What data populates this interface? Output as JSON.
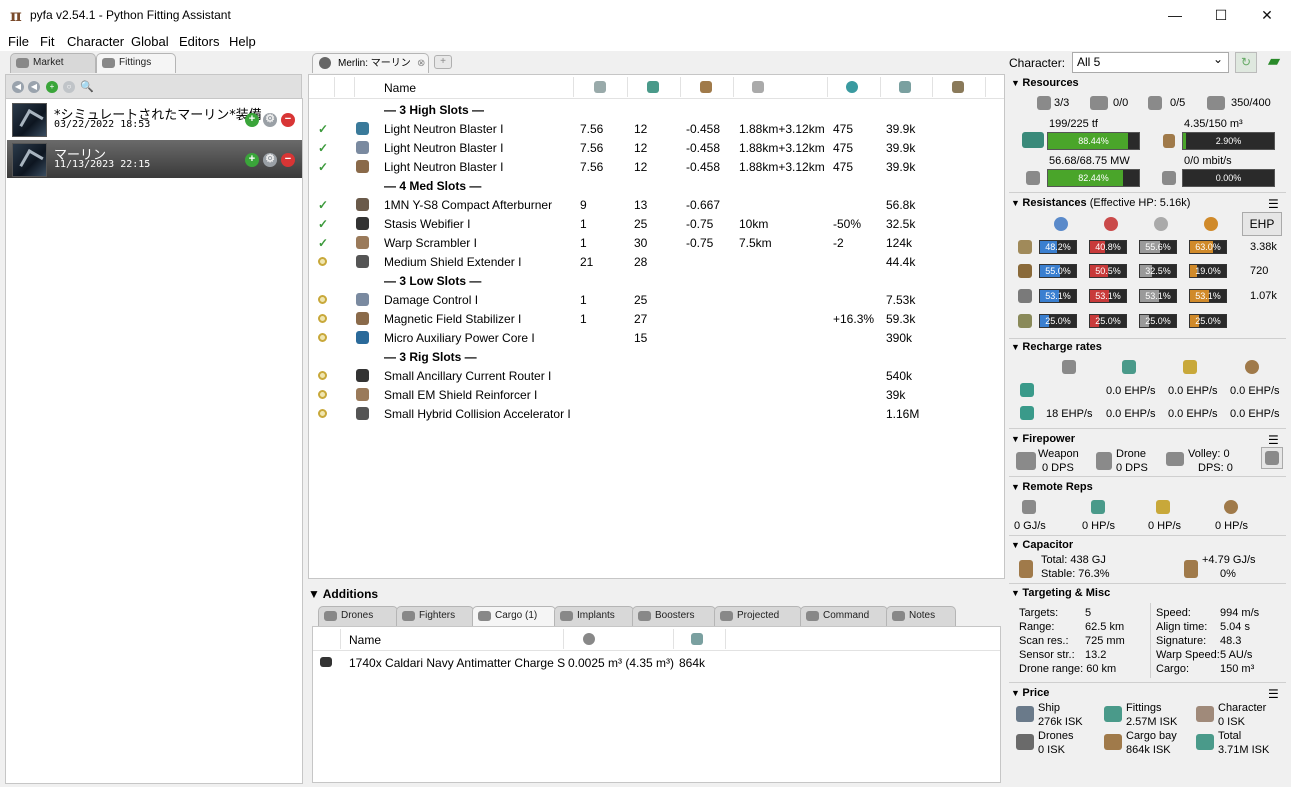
{
  "window": {
    "title": "pyfa v2.54.1 - Python Fitting Assistant",
    "icon": "pyfa-logo-icon"
  },
  "menu": [
    "File",
    "Fit",
    "Character",
    "Global",
    "Editors",
    "Help"
  ],
  "left": {
    "tabs": [
      "Market",
      "Fittings"
    ],
    "fits": [
      {
        "name": "*シミュレートされたマーリン*装備",
        "date": "03/22/2022 18:53"
      },
      {
        "name": "マーリン",
        "date": "11/13/2023 22:15"
      }
    ]
  },
  "fit_tab": "Merlin: マーリン",
  "grid": {
    "name_header": "Name",
    "rows": [
      {
        "kind": "header",
        "name": "3 High Slots"
      },
      {
        "kind": "mod",
        "state": "on",
        "name": "Light Neutron Blaster I",
        "c1": "7.56",
        "c2": "12",
        "c3": "-0.458",
        "c4": "1.88km+3.12km",
        "c5": "475",
        "c6": "39.9k"
      },
      {
        "kind": "mod",
        "state": "on",
        "name": "Light Neutron Blaster I",
        "c1": "7.56",
        "c2": "12",
        "c3": "-0.458",
        "c4": "1.88km+3.12km",
        "c5": "475",
        "c6": "39.9k"
      },
      {
        "kind": "mod",
        "state": "on",
        "name": "Light Neutron Blaster I",
        "c1": "7.56",
        "c2": "12",
        "c3": "-0.458",
        "c4": "1.88km+3.12km",
        "c5": "475",
        "c6": "39.9k"
      },
      {
        "kind": "header",
        "name": "4 Med Slots"
      },
      {
        "kind": "mod",
        "state": "on",
        "name": "1MN Y-S8 Compact Afterburner",
        "c1": "9",
        "c2": "13",
        "c3": "-0.667",
        "c4": "",
        "c5": "",
        "c6": "56.8k"
      },
      {
        "kind": "mod",
        "state": "on",
        "name": "Stasis Webifier I",
        "c1": "1",
        "c2": "25",
        "c3": "-0.75",
        "c4": "10km",
        "c5": "-50%",
        "c6": "32.5k"
      },
      {
        "kind": "mod",
        "state": "on",
        "name": "Warp Scrambler I",
        "c1": "1",
        "c2": "30",
        "c3": "-0.75",
        "c4": "7.5km",
        "c5": "-2",
        "c6": "124k"
      },
      {
        "kind": "mod",
        "state": "off",
        "name": "Medium Shield Extender I",
        "c1": "21",
        "c2": "28",
        "c3": "",
        "c4": "",
        "c5": "",
        "c6": "44.4k"
      },
      {
        "kind": "header",
        "name": "3 Low Slots"
      },
      {
        "kind": "mod",
        "state": "off",
        "name": "Damage Control I",
        "c1": "1",
        "c2": "25",
        "c3": "",
        "c4": "",
        "c5": "",
        "c6": "7.53k"
      },
      {
        "kind": "mod",
        "state": "off",
        "name": "Magnetic Field Stabilizer I",
        "c1": "1",
        "c2": "27",
        "c3": "",
        "c4": "",
        "c5": "+16.3%",
        "c6": "59.3k"
      },
      {
        "kind": "mod",
        "state": "off",
        "name": "Micro Auxiliary Power Core I",
        "c1": "",
        "c2": "15",
        "c3": "",
        "c4": "",
        "c5": "",
        "c6": "390k"
      },
      {
        "kind": "header",
        "name": "3 Rig Slots"
      },
      {
        "kind": "mod",
        "state": "off",
        "name": "Small Ancillary Current Router I",
        "c1": "",
        "c2": "",
        "c3": "",
        "c4": "",
        "c5": "",
        "c6": "540k"
      },
      {
        "kind": "mod",
        "state": "off",
        "name": "Small EM Shield Reinforcer I",
        "c1": "",
        "c2": "",
        "c3": "",
        "c4": "",
        "c5": "",
        "c6": "39k"
      },
      {
        "kind": "mod",
        "state": "off",
        "name": "Small Hybrid Collision Accelerator I",
        "c1": "",
        "c2": "",
        "c3": "",
        "c4": "",
        "c5": "",
        "c6": "1.16M"
      }
    ]
  },
  "additions": {
    "title": "Additions",
    "tabs": [
      "Drones",
      "Fighters",
      "Cargo (1)",
      "Implants",
      "Boosters",
      "Projected",
      "Command",
      "Notes"
    ],
    "cargo_header": "Name",
    "cargo": [
      {
        "name": "1740x Caldari Navy Antimatter Charge S",
        "vol": "0.0025 m³ (4.35 m³)",
        "price": "864k"
      }
    ]
  },
  "right": {
    "character_label": "Character:",
    "character_value": "All 5",
    "resources": {
      "title": "Resources",
      "hard": "3/3",
      "turret": "0/0",
      "launcher": "0/5",
      "calib": "350/400",
      "cpu_text": "199/225 tf",
      "cpu_pct": "88.44%",
      "cpu_frac": 0.8844,
      "drone_bay": "4.35/150 m³",
      "drone_bay_pct": "2.90%",
      "drone_bay_frac": 0.029,
      "pg_text": "56.68/68.75 MW",
      "pg_pct": "82.44%",
      "pg_frac": 0.8244,
      "bw_text": "0/0 mbit/s",
      "bw_pct": "0.00%",
      "bw_frac": 0
    },
    "resist": {
      "title": "Resistances",
      "ehp_note": "(Effective HP: 5.16k)",
      "ehp_btn": "EHP",
      "rows": [
        {
          "vals": [
            "48.2%",
            "40.8%",
            "55.6%",
            "63.0%"
          ],
          "fr": [
            0.482,
            0.408,
            0.556,
            0.63
          ],
          "hp": "3.38k"
        },
        {
          "vals": [
            "55.0%",
            "50.5%",
            "32.5%",
            "19.0%"
          ],
          "fr": [
            0.55,
            0.505,
            0.325,
            0.19
          ],
          "hp": "720"
        },
        {
          "vals": [
            "53.1%",
            "53.1%",
            "53.1%",
            "53.1%"
          ],
          "fr": [
            0.531,
            0.531,
            0.531,
            0.531
          ],
          "hp": "1.07k"
        },
        {
          "vals": [
            "25.0%",
            "25.0%",
            "25.0%",
            "25.0%"
          ],
          "fr": [
            0.25,
            0.25,
            0.25,
            0.25
          ],
          "hp": ""
        }
      ],
      "colors": [
        "#3a7fd0",
        "#c83a3a",
        "#9a9a9a",
        "#d08a2a"
      ]
    },
    "recharge": {
      "title": "Recharge rates",
      "r1": [
        "0.0 EHP/s",
        "0.0 EHP/s",
        "0.0 EHP/s"
      ],
      "r2": [
        "18 EHP/s",
        "0.0 EHP/s",
        "0.0 EHP/s"
      ]
    },
    "firepower": {
      "title": "Firepower",
      "weapon": "Weapon",
      "weapon_dps": "0 DPS",
      "drone": "Drone",
      "drone_dps": "0 DPS",
      "volley": "Volley: 0",
      "dps": "DPS: 0"
    },
    "remote": {
      "title": "Remote Reps",
      "vals": [
        "0 GJ/s",
        "0 HP/s",
        "0 HP/s",
        "0 HP/s"
      ]
    },
    "capacitor": {
      "title": "Capacitor",
      "total": "Total: 438 GJ",
      "stable": "Stable: 76.3%",
      "rate": "+4.79 GJ/s",
      "rate_pct": "0%"
    },
    "targeting": {
      "title": "Targeting & Misc",
      "left": [
        [
          "Targets:",
          "5"
        ],
        [
          "Range:",
          "62.5 km"
        ],
        [
          "Scan res.:",
          "725 mm"
        ],
        [
          "Sensor str.:",
          "13.2"
        ]
      ],
      "drone_range": "Drone range: 60 km",
      "right": [
        [
          "Speed:",
          "994 m/s"
        ],
        [
          "Align time:",
          "5.04 s"
        ],
        [
          "Signature:",
          "48.3"
        ],
        [
          "Warp Speed:",
          "5 AU/s"
        ],
        [
          "Cargo:",
          "150 m³"
        ]
      ]
    },
    "price": {
      "title": "Price",
      "items": [
        [
          "Ship",
          "276k ISK"
        ],
        [
          "Fittings",
          "2.57M ISK"
        ],
        [
          "Character",
          "0 ISK"
        ],
        [
          "Drones",
          "0 ISK"
        ],
        [
          "Cargo bay",
          "864k ISK"
        ],
        [
          "Total",
          "3.71M ISK"
        ]
      ]
    }
  }
}
